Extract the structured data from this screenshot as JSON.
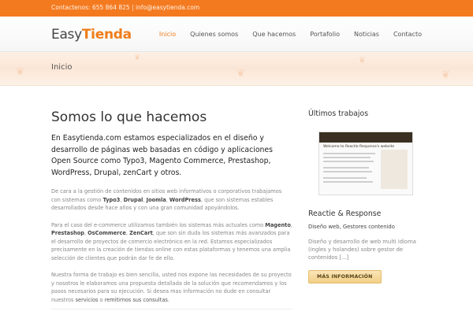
{
  "topbar": {
    "contact": "Contactenos: 655 864 825  |  info@easytienda.com"
  },
  "logo": {
    "part1": "Easy",
    "part2": "Tienda"
  },
  "nav": {
    "items": [
      "Inicio",
      "Quienes somos",
      "Que hacemos",
      "Portafolio",
      "Noticias",
      "Contacto"
    ]
  },
  "banner": {
    "title": "Inicio"
  },
  "main": {
    "title": "Somos lo que hacemos",
    "lead": "En Easytienda.com estamos especializados en el diseño y desarrollo de páginas web basadas en código y aplicaciones Open Source como Typo3, Magento Commerce, Prestashop, WordPress, Drupal, zenCart y otros.",
    "p1": {
      "t1": "De cara a la gestión de contenidos en sitios web informativos o corporativos trabajamos con sistemas como ",
      "b1": "Typo3",
      "s1": ", ",
      "b2": "Drupal",
      "s2": ", ",
      "b3": "Joomla",
      "s3": ", ",
      "b4": "WordPress",
      "t2": ", que son sistemas estables desarrollados desde hace años y con una gran comunidad apoyándolos."
    },
    "p2": {
      "t1": "Para el caso del e-commerce utilizamos también los sistemas más actuales como ",
      "b1": "Magento",
      "s1": ", ",
      "b2": "Prestashop",
      "s2": ", ",
      "b3": "OsCommerce",
      "s3": ", ",
      "b4": "ZenCart",
      "t2": ", que son sin duda los sistemas más avanzados para el desarrollo de proyectos de comercio electrónico en la red. Estamos especializados precisamente en la creación de tiendas online con estas plataformas y tenemos una amplia selección de clientes que podrán dar fe de ello."
    },
    "p3": {
      "t1": "Nuestra forma de trabajo es bien sencilla, usted nos expone las necesidades de su proyecto y nosotros le elaboramos una propuesta detallada de la solución que recomendamos y los pasos necesarios para su ejecución. Si desea mas información no dude en consultar nuestros ",
      "link1": "servicios",
      "mid": " o ",
      "link2": "remitirnos sus consultas",
      "t2": "."
    }
  },
  "sidebar": {
    "title": "Últimos trabajos",
    "thumb_text": "Welcome to Reactie Response's website",
    "work_title": "Reactie & Response",
    "work_sub": "Diseño web, Gestores contenido",
    "work_desc": "Diseño y desarrollo de web multi idioma (ingles y holandes) sobre gestor de contenidos [...]",
    "button": "MÁS INFORMACIÓN"
  },
  "colors": {
    "accent": "#f47a20",
    "logo_accent": "#ef7d1a",
    "button": "#f1cf86"
  }
}
